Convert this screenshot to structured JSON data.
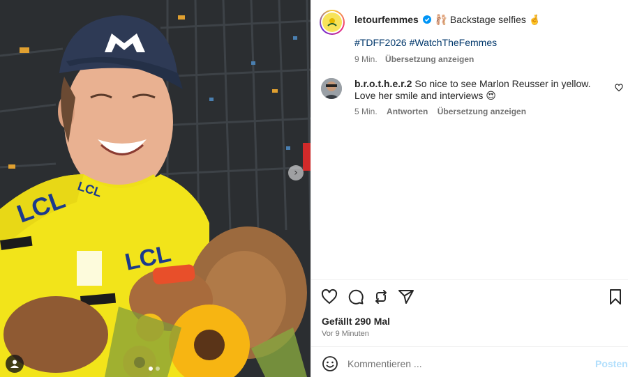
{
  "post": {
    "author": "letourfemmes",
    "caption_text": "Backstage selfies",
    "caption_emojis": [
      "🩰",
      "🤞"
    ],
    "hashtags": "#TDFF2026 #WatchTheFemmes",
    "time_ago": "9 Min.",
    "translate_label": "Übersetzung anzeigen",
    "likes_label": "Gefällt 290 Mal",
    "posted_label": "Vor 9 Minuten"
  },
  "comment": {
    "author": "b.r.o.t.h.e.r.2",
    "text": "So nice to see Marlon Reusser in yellow. Love her smile and interviews 😍",
    "time_ago": "5 Min.",
    "reply_label": "Antworten",
    "translate_label": "Übersetzung anzeigen"
  },
  "comment_box": {
    "placeholder": "Kommentieren ...",
    "post_label": "Posten"
  },
  "photo": {
    "jersey_texts": [
      "LCL",
      "LCL",
      "LCL"
    ],
    "icons": [
      "chevron-right-icon",
      "person-tag-icon"
    ]
  },
  "colors": {
    "link": "#00376b",
    "verified": "#0095f6",
    "jersey_yellow": "#f2e41a",
    "cap_navy": "#2e3a55",
    "post_disabled": "#b2dffc"
  }
}
